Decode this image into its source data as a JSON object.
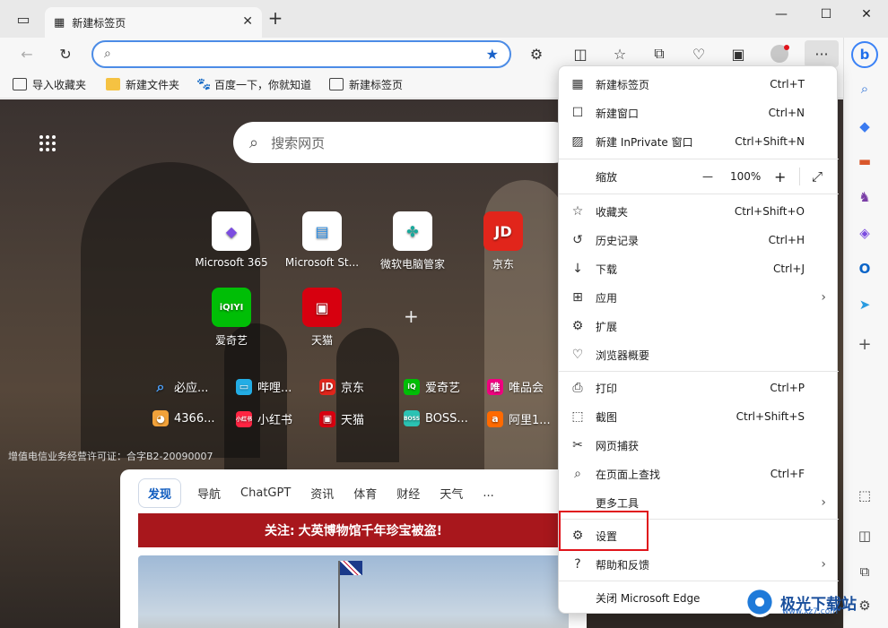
{
  "tab": {
    "title": "新建标签页"
  },
  "address": {
    "placeholder": ""
  },
  "favorites": [
    {
      "label": "导入收藏夹"
    },
    {
      "label": "新建文件夹"
    },
    {
      "label": "百度一下，你就知道"
    },
    {
      "label": "新建标签页"
    }
  ],
  "newtab": {
    "search_placeholder": "搜索网页",
    "tiles": [
      {
        "label": "Microsoft 365",
        "icon": "microsoft-365-icon"
      },
      {
        "label": "Microsoft St...",
        "icon": "microsoft-store-icon"
      },
      {
        "label": "微软电脑管家",
        "icon": "pc-manager-icon"
      },
      {
        "label": "京东",
        "icon": "jd-icon",
        "glyph": "JD"
      },
      {
        "label": "爱奇艺",
        "icon": "iqiyi-icon",
        "glyph": "iQIYI"
      },
      {
        "label": "天猫",
        "icon": "tmall-icon"
      }
    ],
    "links_row1": [
      {
        "label": "必应...",
        "color": "#2a6fd6"
      },
      {
        "label": "哔哩...",
        "color": "#23ade5"
      },
      {
        "label": "京东",
        "color": "#e1251b",
        "glyph": "JD"
      },
      {
        "label": "爱奇艺",
        "color": "#00be06",
        "glyph": "iQ"
      },
      {
        "label": "唯品会",
        "color": "#f10180",
        "glyph": "唯"
      }
    ],
    "links_row2": [
      {
        "label": "4366...",
        "color": "#f2a23a"
      },
      {
        "label": "小红书",
        "color": "#ff2442",
        "glyph": "小红书"
      },
      {
        "label": "天猫",
        "color": "#d7000f"
      },
      {
        "label": "BOSS...",
        "color": "#2bc2b3",
        "glyph": "BOSS"
      },
      {
        "label": "阿里1...",
        "color": "#ff6a00"
      }
    ],
    "icp": "增值电信业务经营许可证：合字B2-20090007",
    "feed_tabs": [
      "发现",
      "导航",
      "ChatGPT",
      "资讯",
      "体育",
      "财经",
      "天气",
      "..."
    ],
    "banner_prefix": "关注:",
    "banner_text": "大英博物馆千年珍宝被盗!"
  },
  "menu": {
    "new_tab": {
      "label": "新建标签页",
      "shortcut": "Ctrl+T"
    },
    "new_window": {
      "label": "新建窗口",
      "shortcut": "Ctrl+N"
    },
    "inprivate": {
      "label": "新建 InPrivate 窗口",
      "shortcut": "Ctrl+Shift+N"
    },
    "zoom": {
      "label": "缩放",
      "minus": "—",
      "value": "100%",
      "plus": "+"
    },
    "favorites": {
      "label": "收藏夹",
      "shortcut": "Ctrl+Shift+O"
    },
    "history": {
      "label": "历史记录",
      "shortcut": "Ctrl+H"
    },
    "downloads": {
      "label": "下载",
      "shortcut": "Ctrl+J"
    },
    "apps": {
      "label": "应用"
    },
    "extensions": {
      "label": "扩展"
    },
    "essentials": {
      "label": "浏览器概要"
    },
    "print": {
      "label": "打印",
      "shortcut": "Ctrl+P"
    },
    "screenshot": {
      "label": "截图",
      "shortcut": "Ctrl+Shift+S"
    },
    "web_capture": {
      "label": "网页捕获"
    },
    "find": {
      "label": "在页面上查找",
      "shortcut": "Ctrl+F"
    },
    "more_tools": {
      "label": "更多工具"
    },
    "settings": {
      "label": "设置"
    },
    "help": {
      "label": "帮助和反馈"
    },
    "close": {
      "label": "关闭 Microsoft Edge"
    }
  },
  "watermark": {
    "title": "极光下载站",
    "url": "www.xz7.com"
  }
}
